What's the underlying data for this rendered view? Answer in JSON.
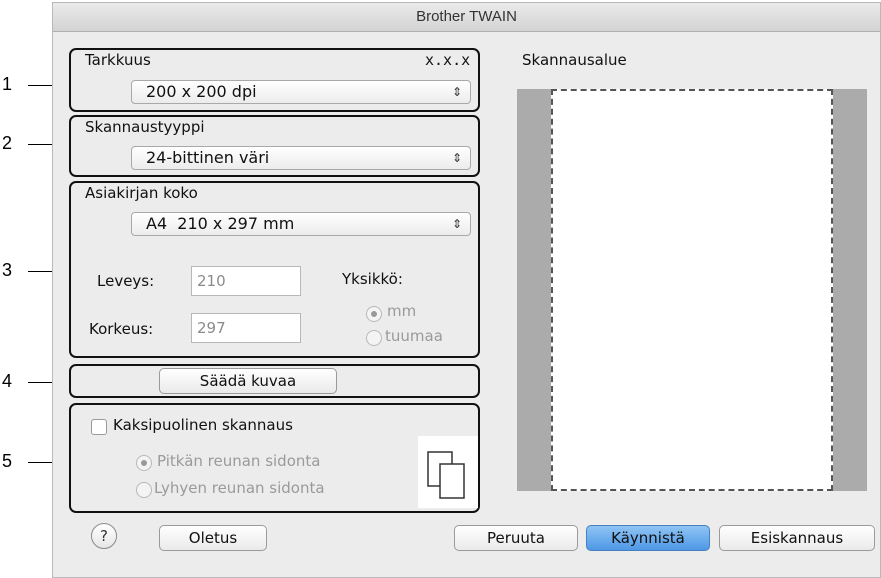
{
  "window": {
    "title": "Brother TWAIN"
  },
  "callouts": [
    "1",
    "2",
    "3",
    "4",
    "5"
  ],
  "resolution": {
    "label": "Tarkkuus",
    "version": "x.x.x",
    "value": "200 x 200 dpi"
  },
  "scan_type": {
    "label": "Skannaustyyppi",
    "value": "24-bittinen väri"
  },
  "document_size": {
    "label": "Asiakirjan koko",
    "value": "A4  210 x 297 mm",
    "width_label": "Leveys:",
    "width_value": "210",
    "height_label": "Korkeus:",
    "height_value": "297",
    "unit_label": "Yksikkö:",
    "unit_mm": "mm",
    "unit_inch": "tuumaa"
  },
  "adjust_button": "Säädä kuvaa",
  "duplex": {
    "label": "Kaksipuolinen skannaus",
    "long_edge": "Pitkän reunan sidonta",
    "short_edge": "Lyhyen reunan sidonta"
  },
  "scan_area": {
    "label": "Skannausalue"
  },
  "buttons": {
    "help": "?",
    "default": "Oletus",
    "cancel": "Peruuta",
    "start": "Käynnistä",
    "prescan": "Esiskannaus"
  }
}
